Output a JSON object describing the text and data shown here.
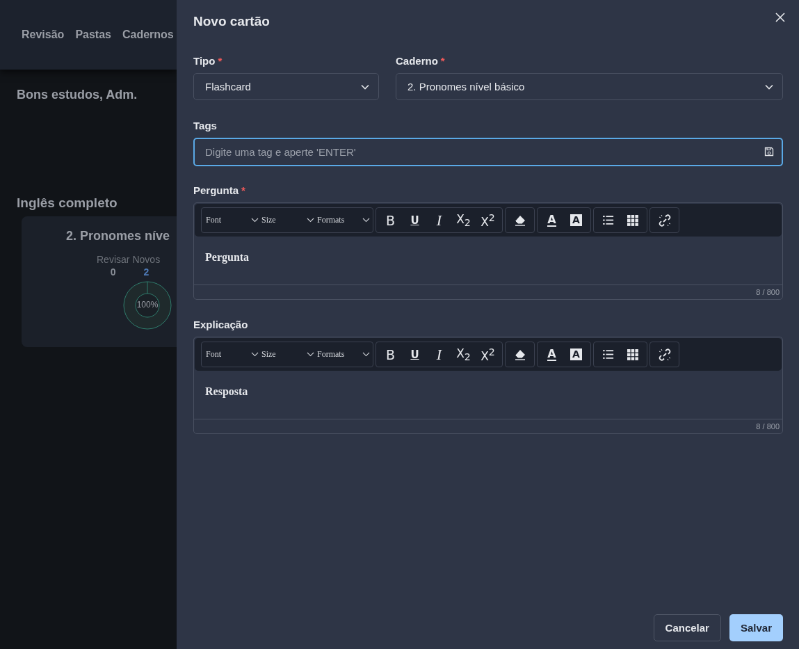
{
  "background": {
    "nav": [
      {
        "label": "Revisão"
      },
      {
        "label": "Pastas"
      },
      {
        "label": "Cadernos"
      }
    ],
    "greeting": "Bons estudos, Adm.",
    "section_title": "Inglês completo",
    "deck_card": {
      "title": "2. Pronomes níve",
      "stats": [
        {
          "label": "Revisar",
          "value": "0",
          "kind": "review"
        },
        {
          "label": "Novos",
          "value": "2",
          "kind": "new"
        }
      ],
      "progress_label": "100%"
    }
  },
  "drawer": {
    "title": "Novo cartão",
    "tipo": {
      "label": "Tipo",
      "required_mark": "*",
      "value": "Flashcard"
    },
    "caderno": {
      "label": "Caderno",
      "required_mark": "*",
      "value": "2. Pronomes nível básico"
    },
    "tags": {
      "label": "Tags",
      "placeholder": "Digite uma tag e aperte 'ENTER'",
      "focused": true
    },
    "editors": [
      {
        "label": "Pergunta",
        "required_mark": "*",
        "content": "Pergunta",
        "counter": "8 / 800",
        "selects": [
          "Font",
          "Size",
          "Formats"
        ],
        "tool_groups": [
          [
            {
              "kind": "bold",
              "label": "B"
            },
            {
              "kind": "underline",
              "label": "U"
            },
            {
              "kind": "italic",
              "label": "I"
            },
            {
              "kind": "subscript",
              "label": "X$_{2}$"
            },
            {
              "kind": "superscript",
              "label": "X$^{2}$"
            }
          ],
          [
            {
              "kind": "eraser"
            }
          ],
          [
            {
              "kind": "text-color",
              "label": "A"
            },
            {
              "kind": "bg-color",
              "label": "A"
            }
          ],
          [
            {
              "kind": "ordered-list"
            },
            {
              "kind": "table"
            }
          ],
          [
            {
              "kind": "unlink"
            }
          ]
        ]
      },
      {
        "label": "Explicação",
        "content": "Resposta",
        "counter": "8 / 800",
        "selects": [
          "Font",
          "Size",
          "Formats"
        ],
        "tool_groups": [
          [
            {
              "kind": "bold",
              "label": "B"
            },
            {
              "kind": "underline",
              "label": "U"
            },
            {
              "kind": "italic",
              "label": "I"
            },
            {
              "kind": "subscript",
              "label": "X$_{2}$"
            },
            {
              "kind": "superscript",
              "label": "X$^{2}$"
            }
          ],
          [
            {
              "kind": "eraser"
            }
          ],
          [
            {
              "kind": "text-color",
              "label": "A"
            },
            {
              "kind": "bg-color",
              "label": "A"
            }
          ],
          [
            {
              "kind": "ordered-list"
            },
            {
              "kind": "table"
            }
          ],
          [
            {
              "kind": "unlink"
            }
          ]
        ]
      }
    ],
    "buttons": [
      {
        "label": "Cancelar",
        "kind": "secondary"
      },
      {
        "label": "Salvar",
        "kind": "primary"
      }
    ]
  }
}
